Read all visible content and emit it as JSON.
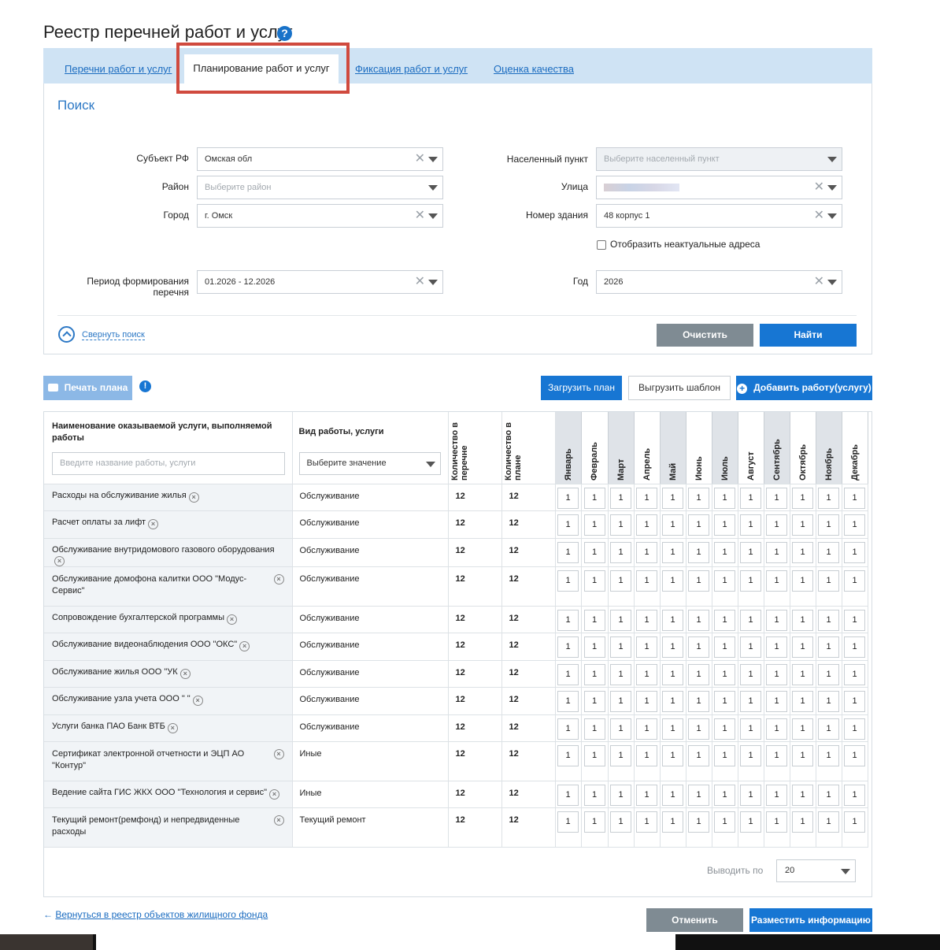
{
  "page": {
    "title": "Реестр перечней работ и услуг"
  },
  "tabs": [
    {
      "label": "Перечни работ и услуг"
    },
    {
      "label": "Планирование работ и услуг"
    },
    {
      "label": "Фиксация работ и услуг"
    },
    {
      "label": "Оценка качества"
    }
  ],
  "search": {
    "title": "Поиск",
    "subject_label": "Субъект РФ",
    "subject_value": "Омская обл",
    "district_label": "Район",
    "district_placeholder": "Выберите район",
    "city_label": "Город",
    "city_value": "г. Омск",
    "period_label": "Период формирования перечня",
    "period_value": "01.2026 - 12.2026",
    "locality_label": "Населенный пункт",
    "locality_placeholder": "Выберите населенный пункт",
    "street_label": "Улица",
    "building_label": "Номер здания",
    "building_value": "48 корпус 1",
    "show_obsolete_label": "Отобразить неактуальные адреса",
    "year_label": "Год",
    "year_value": "2026",
    "collapse_label": "Свернуть поиск",
    "clear_label": "Очистить",
    "find_label": "Найти"
  },
  "toolbar": {
    "print_label": "Печать плана",
    "upload_label": "Загрузить план",
    "template_label": "Выгрузить шаблон",
    "add_label": "Добавить работу(услугу)"
  },
  "table": {
    "col_name": "Наименование оказываемой услуги, выполняемой работы",
    "col_name_placeholder": "Введите название работы, услуги",
    "col_kind": "Вид работы, услуги",
    "col_kind_select": "Выберите значение",
    "col_qty_list": "Количество в перечне",
    "col_qty_plan": "Количество в плане",
    "months": [
      "Январь",
      "Февраль",
      "Март",
      "Апрель",
      "Май",
      "Июнь",
      "Июль",
      "Август",
      "Сентябрь",
      "Октябрь",
      "Ноябрь",
      "Декабрь"
    ],
    "rows": [
      {
        "name": "Расходы на обслуживание жилья",
        "kind": "Обслуживание",
        "qty_list": "12",
        "qty_plan": "12",
        "m": [
          "1",
          "1",
          "1",
          "1",
          "1",
          "1",
          "1",
          "1",
          "1",
          "1",
          "1",
          "1"
        ]
      },
      {
        "name": "Расчет оплаты за лифт",
        "kind": "Обслуживание",
        "qty_list": "12",
        "qty_plan": "12",
        "m": [
          "1",
          "1",
          "1",
          "1",
          "1",
          "1",
          "1",
          "1",
          "1",
          "1",
          "1",
          "1"
        ]
      },
      {
        "name": "Обслуживание внутридомового газового оборудования",
        "kind": "Обслуживание",
        "qty_list": "12",
        "qty_plan": "12",
        "m": [
          "1",
          "1",
          "1",
          "1",
          "1",
          "1",
          "1",
          "1",
          "1",
          "1",
          "1",
          "1"
        ]
      },
      {
        "name": "Обслуживание домофона калитки ООО \"Модус-Сервис\"",
        "kind": "Обслуживание",
        "qty_list": "12",
        "qty_plan": "12",
        "m": [
          "1",
          "1",
          "1",
          "1",
          "1",
          "1",
          "1",
          "1",
          "1",
          "1",
          "1",
          "1"
        ]
      },
      {
        "name": "Сопровождение бухгалтерской программы",
        "kind": "Обслуживание",
        "qty_list": "12",
        "qty_plan": "12",
        "m": [
          "1",
          "1",
          "1",
          "1",
          "1",
          "1",
          "1",
          "1",
          "1",
          "1",
          "1",
          "1"
        ]
      },
      {
        "name": "Обслуживание видеонаблюдения ООО \"ОКС\"",
        "kind": "Обслуживание",
        "qty_list": "12",
        "qty_plan": "12",
        "m": [
          "1",
          "1",
          "1",
          "1",
          "1",
          "1",
          "1",
          "1",
          "1",
          "1",
          "1",
          "1"
        ]
      },
      {
        "name": "Обслуживание жилья ООО \"УК",
        "kind": "Обслуживание",
        "qty_list": "12",
        "qty_plan": "12",
        "m": [
          "1",
          "1",
          "1",
          "1",
          "1",
          "1",
          "1",
          "1",
          "1",
          "1",
          "1",
          "1"
        ]
      },
      {
        "name": "Обслуживание узла учета ООО \"                    \"",
        "kind": "Обслуживание",
        "qty_list": "12",
        "qty_plan": "12",
        "m": [
          "1",
          "1",
          "1",
          "1",
          "1",
          "1",
          "1",
          "1",
          "1",
          "1",
          "1",
          "1"
        ]
      },
      {
        "name": "Услуги банка ПАО Банк ВТБ",
        "kind": "Обслуживание",
        "qty_list": "12",
        "qty_plan": "12",
        "m": [
          "1",
          "1",
          "1",
          "1",
          "1",
          "1",
          "1",
          "1",
          "1",
          "1",
          "1",
          "1"
        ]
      },
      {
        "name": "Сертификат электронной отчетности и ЭЦП АО \"Контур\"",
        "kind": "Иные",
        "qty_list": "12",
        "qty_plan": "12",
        "m": [
          "1",
          "1",
          "1",
          "1",
          "1",
          "1",
          "1",
          "1",
          "1",
          "1",
          "1",
          "1"
        ]
      },
      {
        "name": "Ведение сайта ГИС ЖКХ ООО \"Технология и сервис\"",
        "kind": "Иные",
        "qty_list": "12",
        "qty_plan": "12",
        "m": [
          "1",
          "1",
          "1",
          "1",
          "1",
          "1",
          "1",
          "1",
          "1",
          "1",
          "1",
          "1"
        ]
      },
      {
        "name": "Текущий ремонт(ремфонд) и непредвиденные расходы",
        "kind": "Текущий ремонт",
        "qty_list": "12",
        "qty_plan": "12",
        "m": [
          "1",
          "1",
          "1",
          "1",
          "1",
          "1",
          "1",
          "1",
          "1",
          "1",
          "1",
          "1"
        ]
      }
    ]
  },
  "pager": {
    "label": "Выводить по",
    "value": "20"
  },
  "footer": {
    "back_link": "Вернуться в реестр объектов жилищного фонда",
    "cancel_label": "Отменить",
    "publish_label": "Разместить информацию"
  },
  "colors": {
    "accent": "#1776d3",
    "tabs_bg": "#cfe3f4",
    "highlight": "#d04a3e",
    "gray_button": "#7f8b93"
  }
}
